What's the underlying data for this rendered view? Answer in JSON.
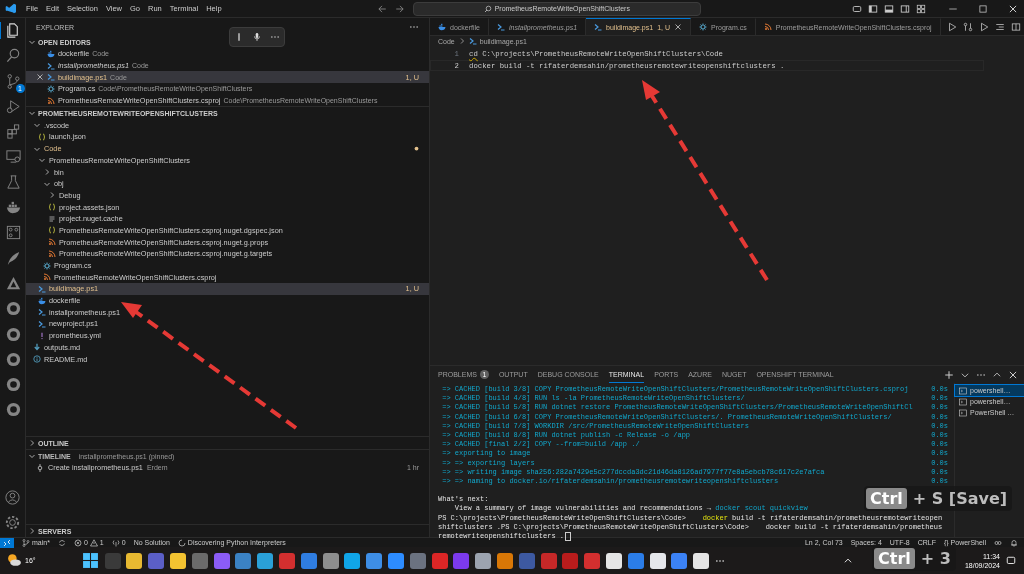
{
  "title_bar": {
    "menu": [
      "File",
      "Edit",
      "Selection",
      "View",
      "Go",
      "Run",
      "Terminal",
      "Help"
    ],
    "search": "PrometheusRemoteWriteOpenShiftClusters"
  },
  "activity_bar": {
    "items": [
      {
        "selected": true
      },
      {
        "selected": false
      },
      {
        "selected": false,
        "badge": "1"
      },
      {
        "selected": false
      },
      {
        "selected": false
      },
      {
        "selected": false
      },
      {
        "selected": false
      },
      {
        "selected": false
      },
      {
        "selected": false
      },
      {
        "selected": false
      },
      {
        "selected": false
      },
      {
        "selected": false
      },
      {
        "selected": false
      },
      {
        "selected": false
      },
      {
        "selected": false
      },
      {
        "selected": false
      }
    ]
  },
  "sidebar": {
    "title": "EXPLORER",
    "open_editors": {
      "title": "OPEN EDITORS",
      "expanded": true,
      "items": [
        {
          "kind": "docker",
          "name": "dockerfile",
          "description": "Code",
          "preview": false,
          "modified": false,
          "selected": false
        },
        {
          "kind": "powershell",
          "name": "installprometheus.ps1",
          "description": "Code",
          "preview": true,
          "modified": false,
          "selected": false
        },
        {
          "kind": "powershell",
          "name": "buildimage.ps1",
          "description": "Code",
          "preview": false,
          "modified": true,
          "status": "1, U",
          "selected": true
        },
        {
          "kind": "csharp",
          "name": "Program.cs",
          "description": "Code\\PrometheusRemoteWriteOpenShiftClusters",
          "preview": false,
          "modified": false,
          "selected": false
        },
        {
          "kind": "xml",
          "name": "PrometheusRemoteWriteOpenShiftClusters.csproj",
          "description": "Code\\PrometheusRemoteWriteOpenShiftClusters",
          "preview": false,
          "modified": false,
          "selected": false
        }
      ]
    },
    "folder": {
      "title": "PROMETHEUSREMOTEWRITEOPENSHIFTCLUSTERS",
      "expanded": true,
      "items": [
        {
          "name": ".vscode",
          "kind": "folder",
          "expanded": true,
          "modified": false,
          "selected": false,
          "children": [
            {
              "name": "launch.json",
              "kind": "json",
              "modified": false,
              "selected": false
            }
          ]
        },
        {
          "name": "Code",
          "kind": "folder",
          "expanded": true,
          "modified": true,
          "selected": false,
          "children": [
            {
              "name": "PrometheusRemoteWriteOpenShiftClusters",
              "kind": "folder",
              "expanded": true,
              "modified": false,
              "selected": false,
              "children": [
                {
                  "name": "bin",
                  "kind": "folder",
                  "expanded": false,
                  "modified": false,
                  "selected": false
                },
                {
                  "name": "obj",
                  "kind": "folder",
                  "expanded": true,
                  "modified": false,
                  "selected": false,
                  "children": [
                    {
                      "name": "Debug",
                      "kind": "folder",
                      "expanded": false,
                      "modified": false,
                      "selected": false
                    },
                    {
                      "name": "project.assets.json",
                      "kind": "json",
                      "modified": false,
                      "selected": false
                    },
                    {
                      "name": "project.nuget.cache",
                      "kind": "text",
                      "modified": false,
                      "selected": false
                    },
                    {
                      "name": "PrometheusRemoteWriteOpenShiftClusters.csproj.nuget.dgspec.json",
                      "kind": "json",
                      "modified": false,
                      "selected": false
                    },
                    {
                      "name": "PrometheusRemoteWriteOpenShiftClusters.csproj.nuget.g.props",
                      "kind": "xml",
                      "modified": false,
                      "selected": false
                    },
                    {
                      "name": "PrometheusRemoteWriteOpenShiftClusters.csproj.nuget.g.targets",
                      "kind": "xml",
                      "modified": false,
                      "selected": false
                    }
                  ]
                },
                {
                  "name": "Program.cs",
                  "kind": "csharp",
                  "modified": false,
                  "selected": false
                },
                {
                  "name": "PrometheusRemoteWriteOpenShiftClusters.csproj",
                  "kind": "xml",
                  "modified": false,
                  "selected": false
                }
              ]
            },
            {
              "name": "buildimage.ps1",
              "kind": "powershell",
              "modified": true,
              "status": "1, U",
              "selected": true
            },
            {
              "name": "dockerfile",
              "kind": "docker",
              "modified": false,
              "selected": false
            },
            {
              "name": "installprometheus.ps1",
              "kind": "powershell",
              "modified": false,
              "selected": false
            },
            {
              "name": "newproject.ps1",
              "kind": "powershell",
              "modified": false,
              "selected": false
            },
            {
              "name": "prometheus.yml",
              "kind": "yaml",
              "modified": false,
              "selected": false
            }
          ]
        },
        {
          "name": "outputs.md",
          "kind": "markdown",
          "modified": false,
          "selected": false
        },
        {
          "name": "README.md",
          "kind": "info",
          "modified": false,
          "selected": false
        }
      ]
    },
    "outline": {
      "title": "OUTLINE",
      "expanded": false
    },
    "timeline": {
      "title": "TIMELINE",
      "description": "installprometheus.ps1 (pinned)",
      "expanded": true,
      "items": [
        {
          "label": "Create installprometheus.ps1",
          "author": "Erdem",
          "time": "1 hr"
        }
      ]
    },
    "servers": {
      "title": "SERVERS",
      "expanded": false
    }
  },
  "editor": {
    "tabs": [
      {
        "kind": "docker",
        "label": "dockerfile",
        "preview": false,
        "modified": false,
        "selected": false
      },
      {
        "kind": "powershell",
        "label": "installprometheus.ps1",
        "preview": true,
        "modified": false,
        "selected": false
      },
      {
        "kind": "powershell",
        "label": "buildimage.ps1",
        "status": "1, U",
        "preview": false,
        "modified": true,
        "selected": true
      },
      {
        "kind": "csharp",
        "label": "Program.cs",
        "preview": false,
        "modified": false,
        "selected": false
      },
      {
        "kind": "xml",
        "label": "PrometheusRemoteWriteOpenShiftClusters.csproj",
        "preview": false,
        "modified": false,
        "selected": false
      }
    ],
    "breadcrumb": [
      {
        "kind": "folder",
        "label": "Code"
      },
      {
        "kind": "powershell",
        "label": "buildimage.ps1"
      }
    ],
    "lines": [
      {
        "number": "1",
        "current": false,
        "tokens": [
          {
            "text": "cd",
            "warning": true
          },
          {
            "text": " C:\\projects\\PrometheusRemoteWriteOpenShiftClusters\\Code",
            "warning": false
          }
        ]
      },
      {
        "number": "2",
        "current": true,
        "tokens": [
          {
            "text": "docker build -t rifaterdemsahin/prometheusremotewriteopenshiftclusters .",
            "warning": false
          }
        ]
      }
    ]
  },
  "panel": {
    "tabs": [
      {
        "label": "PROBLEMS",
        "badge": "1",
        "selected": false
      },
      {
        "label": "OUTPUT",
        "selected": false
      },
      {
        "label": "DEBUG CONSOLE",
        "selected": false
      },
      {
        "label": "TERMINAL",
        "selected": true
      },
      {
        "label": "PORTS",
        "selected": false
      },
      {
        "label": "AZURE",
        "selected": false
      },
      {
        "label": "NUGET",
        "selected": false
      },
      {
        "label": "OPENSHIFT TERMINAL",
        "selected": false
      }
    ],
    "terminal": {
      "lines": [
        {
          "kind": "step",
          "text": "=> CACHED [build 3/8] COPY PrometheusRemoteWriteOpenShiftClusters/PrometheusRemoteWriteOpenShiftClusters.csproj",
          "time": "0.0s"
        },
        {
          "kind": "step",
          "text": "=> CACHED [build 4/8] RUN ls -la PrometheusRemoteWriteOpenShiftClusters/",
          "time": "0.0s"
        },
        {
          "kind": "step",
          "text": "=> CACHED [build 5/8] RUN dotnet restore PrometheusRemoteWriteOpenShiftClusters/PrometheusRemoteWriteOpenShiftCl",
          "time": "0.0s"
        },
        {
          "kind": "step",
          "text": "=> CACHED [build 6/8] COPY PrometheusRemoteWriteOpenShiftClusters/. PrometheusRemoteWriteOpenShiftClusters/",
          "time": "0.0s"
        },
        {
          "kind": "step",
          "text": "=> CACHED [build 7/8] WORKDIR /src/PrometheusRemoteWriteOpenShiftClusters",
          "time": "0.0s"
        },
        {
          "kind": "step",
          "text": "=> CACHED [build 8/8] RUN dotnet publish -c Release -o /app",
          "time": "0.0s"
        },
        {
          "kind": "step",
          "text": "=> CACHED [final 2/2] COPY --from=build /app ./",
          "time": "0.0s"
        },
        {
          "kind": "step",
          "text": "=> exporting to image",
          "time": "0.0s"
        },
        {
          "kind": "step",
          "text": "=> => exporting layers",
          "time": "0.0s"
        },
        {
          "kind": "step",
          "text": "=> => writing image sha256:282a7429e5c277dccda3dc21d46da8126ad7977f77e8a5ebcb78c617c2e7afca",
          "time": "0.0s"
        },
        {
          "kind": "step",
          "text": "=> => naming to docker.io/rifaterdemsahin/prometheusremotewriteopenshiftclusters",
          "time": "0.0s"
        },
        {
          "kind": "blank"
        },
        {
          "kind": "heading",
          "text": "What's next:"
        },
        {
          "kind": "hint",
          "text": "    View a summary of image vulnerabilities and recommendations → ",
          "command": "docker scout quickview"
        },
        {
          "kind": "prompt",
          "prompt": "PS C:\\projects\\PrometheusRemoteWriteOpenShiftClusters\\Code>    ",
          "command": "docker",
          "text": " build -t rifaterdemsahin/prometheusremotewriteopen"
        },
        {
          "kind": "plain",
          "text": "shiftclusters .PS C:\\projects\\PrometheusRemoteWriteOpenShiftClusters\\Code>    docker build -t rifaterdemsahin/prometheus",
          "cursor": false
        },
        {
          "kind": "plain",
          "text": "remotewriteopenshiftclusters .",
          "cursor": true
        }
      ],
      "sessions": [
        {
          "label": "powershell…",
          "selected": true
        },
        {
          "label": "powershell…",
          "selected": false
        },
        {
          "label": "PowerShell …",
          "selected": false
        }
      ]
    }
  },
  "status_bar": {
    "branch": "main*",
    "errors": "0",
    "warnings": "1",
    "ports": "0",
    "solution": "No Solution",
    "python": "Discovering Python Interpreters",
    "position": "Ln 2, Col 73",
    "indent": "Spaces: 4",
    "encoding": "UTF-8",
    "eol": "CRLF",
    "language_icon": "{}",
    "language": "PowerShell"
  },
  "taskbar": {
    "weather": "16°",
    "time": "11:34",
    "date": "18/09/2024"
  },
  "key_overlays": [
    {
      "key": "Ctrl",
      "text": "+ S [Save]"
    },
    {
      "key": "Ctrl",
      "text": "+ 3"
    }
  ]
}
